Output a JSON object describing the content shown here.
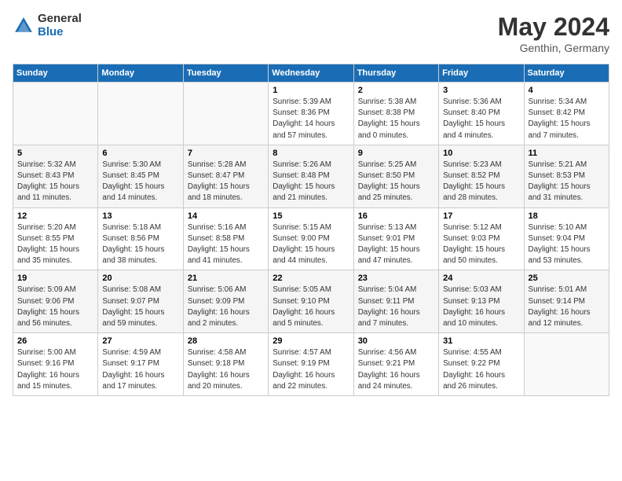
{
  "header": {
    "logo_general": "General",
    "logo_blue": "Blue",
    "month_title": "May 2024",
    "location": "Genthin, Germany"
  },
  "weekdays": [
    "Sunday",
    "Monday",
    "Tuesday",
    "Wednesday",
    "Thursday",
    "Friday",
    "Saturday"
  ],
  "weeks": [
    [
      {
        "day": "",
        "sunrise": "",
        "sunset": "",
        "daylight": ""
      },
      {
        "day": "",
        "sunrise": "",
        "sunset": "",
        "daylight": ""
      },
      {
        "day": "",
        "sunrise": "",
        "sunset": "",
        "daylight": ""
      },
      {
        "day": "1",
        "sunrise": "Sunrise: 5:39 AM",
        "sunset": "Sunset: 8:36 PM",
        "daylight": "Daylight: 14 hours and 57 minutes."
      },
      {
        "day": "2",
        "sunrise": "Sunrise: 5:38 AM",
        "sunset": "Sunset: 8:38 PM",
        "daylight": "Daylight: 15 hours and 0 minutes."
      },
      {
        "day": "3",
        "sunrise": "Sunrise: 5:36 AM",
        "sunset": "Sunset: 8:40 PM",
        "daylight": "Daylight: 15 hours and 4 minutes."
      },
      {
        "day": "4",
        "sunrise": "Sunrise: 5:34 AM",
        "sunset": "Sunset: 8:42 PM",
        "daylight": "Daylight: 15 hours and 7 minutes."
      }
    ],
    [
      {
        "day": "5",
        "sunrise": "Sunrise: 5:32 AM",
        "sunset": "Sunset: 8:43 PM",
        "daylight": "Daylight: 15 hours and 11 minutes."
      },
      {
        "day": "6",
        "sunrise": "Sunrise: 5:30 AM",
        "sunset": "Sunset: 8:45 PM",
        "daylight": "Daylight: 15 hours and 14 minutes."
      },
      {
        "day": "7",
        "sunrise": "Sunrise: 5:28 AM",
        "sunset": "Sunset: 8:47 PM",
        "daylight": "Daylight: 15 hours and 18 minutes."
      },
      {
        "day": "8",
        "sunrise": "Sunrise: 5:26 AM",
        "sunset": "Sunset: 8:48 PM",
        "daylight": "Daylight: 15 hours and 21 minutes."
      },
      {
        "day": "9",
        "sunrise": "Sunrise: 5:25 AM",
        "sunset": "Sunset: 8:50 PM",
        "daylight": "Daylight: 15 hours and 25 minutes."
      },
      {
        "day": "10",
        "sunrise": "Sunrise: 5:23 AM",
        "sunset": "Sunset: 8:52 PM",
        "daylight": "Daylight: 15 hours and 28 minutes."
      },
      {
        "day": "11",
        "sunrise": "Sunrise: 5:21 AM",
        "sunset": "Sunset: 8:53 PM",
        "daylight": "Daylight: 15 hours and 31 minutes."
      }
    ],
    [
      {
        "day": "12",
        "sunrise": "Sunrise: 5:20 AM",
        "sunset": "Sunset: 8:55 PM",
        "daylight": "Daylight: 15 hours and 35 minutes."
      },
      {
        "day": "13",
        "sunrise": "Sunrise: 5:18 AM",
        "sunset": "Sunset: 8:56 PM",
        "daylight": "Daylight: 15 hours and 38 minutes."
      },
      {
        "day": "14",
        "sunrise": "Sunrise: 5:16 AM",
        "sunset": "Sunset: 8:58 PM",
        "daylight": "Daylight: 15 hours and 41 minutes."
      },
      {
        "day": "15",
        "sunrise": "Sunrise: 5:15 AM",
        "sunset": "Sunset: 9:00 PM",
        "daylight": "Daylight: 15 hours and 44 minutes."
      },
      {
        "day": "16",
        "sunrise": "Sunrise: 5:13 AM",
        "sunset": "Sunset: 9:01 PM",
        "daylight": "Daylight: 15 hours and 47 minutes."
      },
      {
        "day": "17",
        "sunrise": "Sunrise: 5:12 AM",
        "sunset": "Sunset: 9:03 PM",
        "daylight": "Daylight: 15 hours and 50 minutes."
      },
      {
        "day": "18",
        "sunrise": "Sunrise: 5:10 AM",
        "sunset": "Sunset: 9:04 PM",
        "daylight": "Daylight: 15 hours and 53 minutes."
      }
    ],
    [
      {
        "day": "19",
        "sunrise": "Sunrise: 5:09 AM",
        "sunset": "Sunset: 9:06 PM",
        "daylight": "Daylight: 15 hours and 56 minutes."
      },
      {
        "day": "20",
        "sunrise": "Sunrise: 5:08 AM",
        "sunset": "Sunset: 9:07 PM",
        "daylight": "Daylight: 15 hours and 59 minutes."
      },
      {
        "day": "21",
        "sunrise": "Sunrise: 5:06 AM",
        "sunset": "Sunset: 9:09 PM",
        "daylight": "Daylight: 16 hours and 2 minutes."
      },
      {
        "day": "22",
        "sunrise": "Sunrise: 5:05 AM",
        "sunset": "Sunset: 9:10 PM",
        "daylight": "Daylight: 16 hours and 5 minutes."
      },
      {
        "day": "23",
        "sunrise": "Sunrise: 5:04 AM",
        "sunset": "Sunset: 9:11 PM",
        "daylight": "Daylight: 16 hours and 7 minutes."
      },
      {
        "day": "24",
        "sunrise": "Sunrise: 5:03 AM",
        "sunset": "Sunset: 9:13 PM",
        "daylight": "Daylight: 16 hours and 10 minutes."
      },
      {
        "day": "25",
        "sunrise": "Sunrise: 5:01 AM",
        "sunset": "Sunset: 9:14 PM",
        "daylight": "Daylight: 16 hours and 12 minutes."
      }
    ],
    [
      {
        "day": "26",
        "sunrise": "Sunrise: 5:00 AM",
        "sunset": "Sunset: 9:16 PM",
        "daylight": "Daylight: 16 hours and 15 minutes."
      },
      {
        "day": "27",
        "sunrise": "Sunrise: 4:59 AM",
        "sunset": "Sunset: 9:17 PM",
        "daylight": "Daylight: 16 hours and 17 minutes."
      },
      {
        "day": "28",
        "sunrise": "Sunrise: 4:58 AM",
        "sunset": "Sunset: 9:18 PM",
        "daylight": "Daylight: 16 hours and 20 minutes."
      },
      {
        "day": "29",
        "sunrise": "Sunrise: 4:57 AM",
        "sunset": "Sunset: 9:19 PM",
        "daylight": "Daylight: 16 hours and 22 minutes."
      },
      {
        "day": "30",
        "sunrise": "Sunrise: 4:56 AM",
        "sunset": "Sunset: 9:21 PM",
        "daylight": "Daylight: 16 hours and 24 minutes."
      },
      {
        "day": "31",
        "sunrise": "Sunrise: 4:55 AM",
        "sunset": "Sunset: 9:22 PM",
        "daylight": "Daylight: 16 hours and 26 minutes."
      },
      {
        "day": "",
        "sunrise": "",
        "sunset": "",
        "daylight": ""
      }
    ]
  ]
}
